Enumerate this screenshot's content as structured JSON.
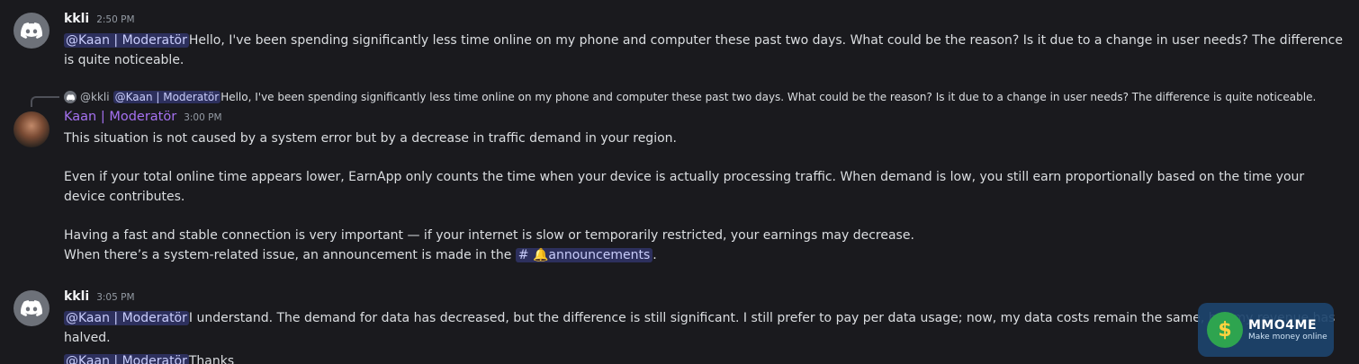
{
  "messages": [
    {
      "username": "kkli",
      "timestamp": "2:50 PM",
      "mention": "@Kaan | Moderatör",
      "text": "Hello, I've been spending significantly less time online on my phone and computer these past two days. What could be the reason? Is it due to a change in user needs? The difference is quite noticeable."
    },
    {
      "reply": {
        "user": "@kkli",
        "mention": "@Kaan | Moderatör",
        "text": "Hello, I've been spending significantly less time online on my phone and computer these past two days. What could be the reason? Is it due to a change in user needs? The difference is quite noticeable."
      },
      "username": "Kaan | Moderatör",
      "timestamp": "3:00 PM",
      "para1": "This situation is not caused by a system error but by a decrease in traffic demand in your region.",
      "para2": "Even if your total online time appears lower, EarnApp only counts the time when your device is actually processing traffic. When demand is low, you still earn proportionally based on the time your device contributes.",
      "para3": "Having a fast and stable connection is very important — if your internet is slow or temporarily restricted, your earnings may decrease.",
      "para4_before": "When there’s a system-related issue, an announcement is made in the",
      "channel_hash": "#",
      "channel_icon": "🔔",
      "channel_name": "announcements",
      "para4_after": "."
    },
    {
      "username": "kkli",
      "timestamp": "3:05 PM",
      "mention1": "@Kaan | Moderatör",
      "text1": "I understand. The demand for data has decreased, but the difference is still significant. I still prefer to pay per data usage; now, my data costs remain the same, but my revenue has halved.",
      "mention2": "@Kaan | Moderatör",
      "text2": "Thanks"
    }
  ],
  "watermark": {
    "logo_symbol": "$",
    "title": "MMO4ME",
    "subtitle": "Make money online"
  },
  "colors": {
    "background": "#1a1a1e",
    "moderator_name": "#a571f0",
    "mention_bg": "#3c4270",
    "text": "#dbdee1"
  }
}
